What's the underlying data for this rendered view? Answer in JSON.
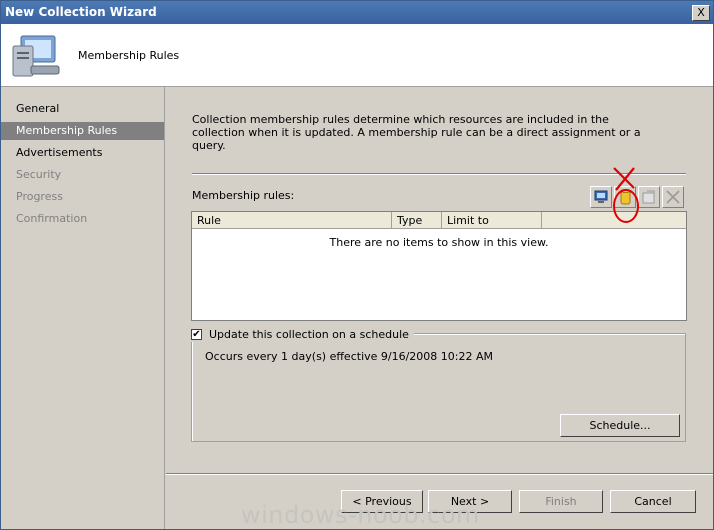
{
  "window": {
    "title": "New Collection Wizard",
    "close_glyph": "X"
  },
  "header": {
    "title": "Membership Rules",
    "icon": "computer-icon"
  },
  "nav": {
    "items": [
      {
        "label": "General",
        "state": "normal"
      },
      {
        "label": "Membership Rules",
        "state": "active"
      },
      {
        "label": "Advertisements",
        "state": "normal"
      },
      {
        "label": "Security",
        "state": "disabled"
      },
      {
        "label": "Progress",
        "state": "disabled"
      },
      {
        "label": "Confirmation",
        "state": "disabled"
      }
    ]
  },
  "main": {
    "intro": "Collection membership rules determine which resources are included in the collection when it is updated. A membership rule can be a direct assignment or a query.",
    "rules_label": "Membership rules:",
    "toolbar": [
      "new-direct-rule-icon",
      "new-query-rule-icon",
      "properties-icon",
      "delete-icon"
    ],
    "columns": [
      "Rule",
      "Type",
      "Limit to"
    ],
    "empty_message": "There are no items to show in this view.",
    "schedule": {
      "checkbox_label": "Update this collection on a schedule",
      "checked": true,
      "description": "Occurs every 1 day(s) effective 9/16/2008 10:22 AM",
      "button": "Schedule..."
    }
  },
  "buttons": {
    "previous": "< Previous",
    "next": "Next >",
    "finish": "Finish",
    "cancel": "Cancel"
  },
  "watermark": "windows-noob.com",
  "colors": {
    "title_bar": "#3863a0",
    "nav_active": "#808080",
    "annotation": "#e00000"
  }
}
